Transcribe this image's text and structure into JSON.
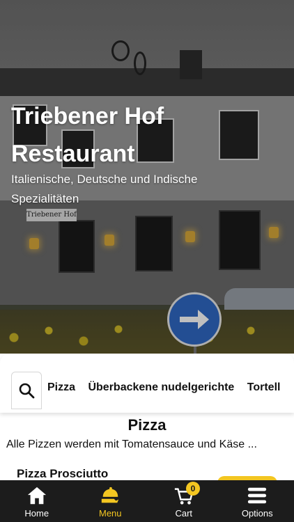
{
  "hero": {
    "title_line1": "Triebener Hof",
    "title_line2": "Restaurant",
    "subtitle_line1": "Italienische, Deutsche und Indische",
    "subtitle_line2": "Spezialitäten",
    "building_sign": "Triebener Hof"
  },
  "categories": {
    "search_icon": "search-icon",
    "tabs": [
      "Pizza",
      "Überbackene nudelgerichte",
      "Tortell"
    ]
  },
  "section": {
    "title": "Pizza",
    "description": "Alle Pizzen werden mit Tomatensauce und Käse ...",
    "first_item": "Pizza Prosciutto"
  },
  "nav": {
    "items": [
      {
        "label": "Home",
        "icon": "home-icon"
      },
      {
        "label": "Menu",
        "icon": "menu-food-icon"
      },
      {
        "label": "Cart",
        "icon": "cart-icon"
      },
      {
        "label": "Options",
        "icon": "options-icon"
      }
    ],
    "active": "Menu",
    "cart_count": "0"
  },
  "colors": {
    "accent": "#f3c621",
    "nav_bg": "#1c1c1c",
    "text": "#111111"
  }
}
